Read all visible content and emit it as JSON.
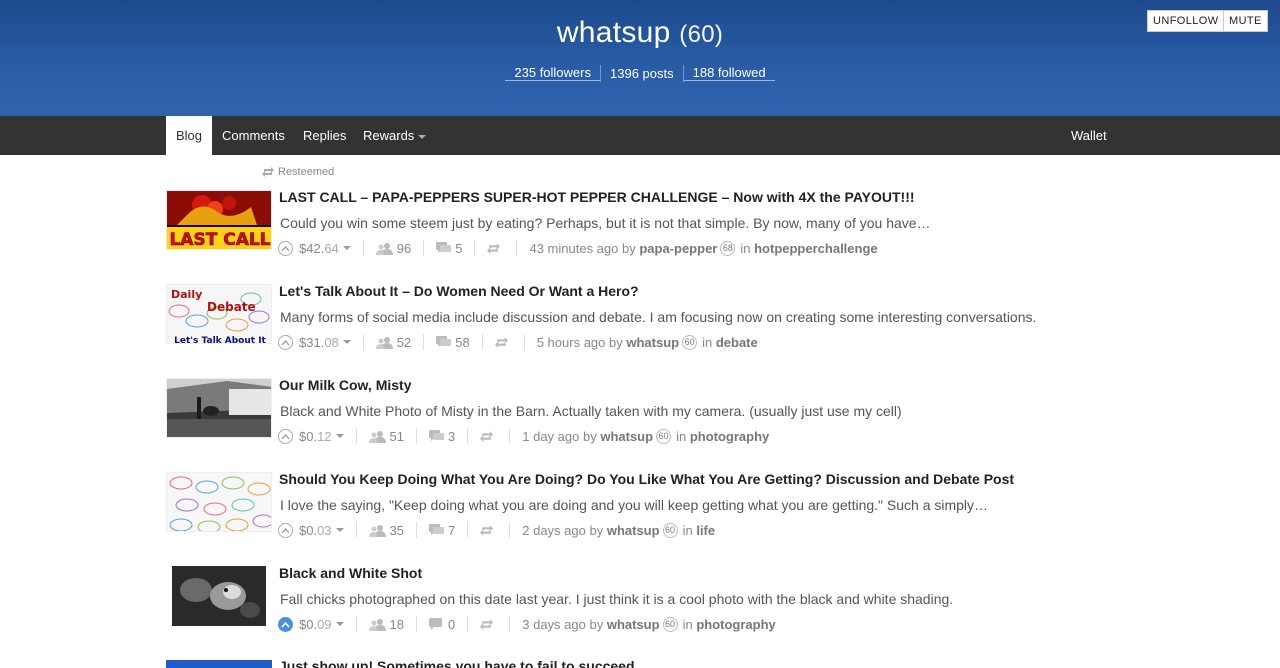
{
  "profile": {
    "username": "whatsup",
    "reputation": "(60)",
    "followers": "235 followers",
    "posts": "1396 posts",
    "followed": "188 followed",
    "unfollow_label": "UNFOLLOW",
    "mute_label": "MUTE"
  },
  "nav": {
    "blog": "Blog",
    "comments": "Comments",
    "replies": "Replies",
    "rewards": "Rewards",
    "wallet": "Wallet"
  },
  "resteemed_label": "Resteemed",
  "posts": [
    {
      "title": "LAST CALL – PAPA-PEPPERS SUPER-HOT PEPPER CHALLENGE – Now with 4X the PAYOUT!!!",
      "body": "Could you win some steem just by eating? Perhaps, but it is not that simple. By now, many of you have…",
      "payout_main": "$42.",
      "payout_dec": "64",
      "votes": "96",
      "comments": "5",
      "time": "43 minutes ago by",
      "author": "papa-pepper",
      "author_rep": "68",
      "in_label": "in",
      "category": "hotpepperchallenge",
      "thumb_text": "LAST CALL"
    },
    {
      "title": "Let's Talk About It – Do Women Need Or Want a Hero?",
      "body": "Many forms of social media include discussion and debate.   I am focusing now on creating some interesting conversations.",
      "payout_main": "$31.",
      "payout_dec": "08",
      "votes": "52",
      "comments": "58",
      "time": "5 hours ago by",
      "author": "whatsup",
      "author_rep": "60",
      "in_label": "in",
      "category": "debate",
      "thumb_text_1": "Daily",
      "thumb_text_2": "Debate",
      "thumb_text_3": "Let's Talk About It"
    },
    {
      "title": "Our Milk Cow, Misty",
      "body": "Black and White Photo of Misty in the Barn.  Actually taken with my camera.  (usually just use my cell)",
      "payout_main": "$0.",
      "payout_dec": "12",
      "votes": "51",
      "comments": "3",
      "time": "1 day ago by",
      "author": "whatsup",
      "author_rep": "60",
      "in_label": "in",
      "category": "photography"
    },
    {
      "title": "Should You Keep Doing What You Are Doing? Do You Like What You Are Getting? Discussion and Debate Post",
      "body": "I love the saying, \"Keep doing what you are doing and you will keep getting what you are getting.\" Such a simply…",
      "payout_main": "$0.",
      "payout_dec": "03",
      "votes": "35",
      "comments": "7",
      "time": "2 days ago by",
      "author": "whatsup",
      "author_rep": "60",
      "in_label": "in",
      "category": "life"
    },
    {
      "title": "Black and White Shot",
      "body": "Fall chicks photographed on this date last year.  I just think it is a cool photo with the black and white shading.",
      "payout_main": "$0.",
      "payout_dec": "09",
      "votes": "18",
      "comments": "0",
      "time": "3 days ago by",
      "author": "whatsup",
      "author_rep": "60",
      "in_label": "in",
      "category": "photography"
    },
    {
      "title": "Just show up! Sometimes you have to fail to succeed"
    }
  ],
  "colors": {
    "header": "#2a5ca6",
    "nav": "#333333",
    "upvoted": "#4a90e2"
  }
}
